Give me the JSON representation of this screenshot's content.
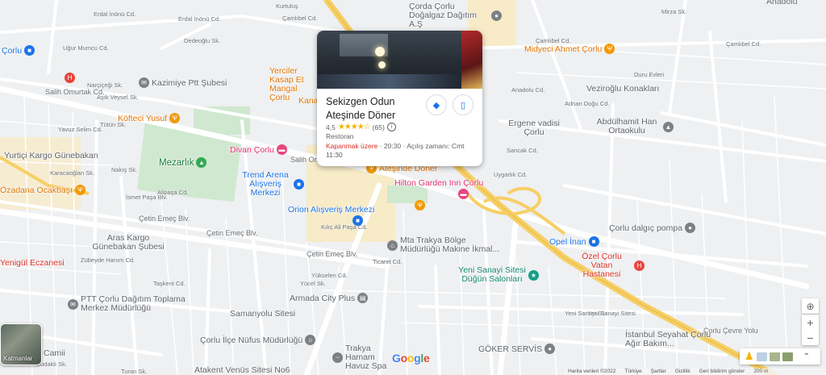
{
  "map": {
    "streets": [
      "Erdal İnönü Cd.",
      "Erdal İnönü Cd.",
      "Kurtuluş",
      "Çamlıbel Cd.",
      "Çamlıbel Cd.",
      "Çamlıbel Cd.",
      "Dedeoğlu Sk.",
      "Uğur Mumcu Cd.",
      "Narçiçeği Sk.",
      "Aşık Veysel Sk.",
      "Salih Omurtak Cd.",
      "Salih Omurtak Cd.",
      "Tütün Sk.",
      "Yavuz Selim Cd.",
      "Nakış Sk.",
      "Karacaoğlan Sk.",
      "İsmet Paşa Blv.",
      "Alipaşa Cd.",
      "Çetin Emeç Blv.",
      "Çetin Emeç Blv.",
      "Çetin Emeç Blv.",
      "Kılıç Ali Paşa Cd.",
      "Ticaret Cd.",
      "Yükselen Cd.",
      "Yücel Sk.",
      "Sancak Cd.",
      "Uygarlık Cd.",
      "Adnan Doğu Cd.",
      "Anadolu Cd.",
      "Duru Evleri",
      "Yeni Sanayi Sk.",
      "Yeni Sanayi Sitesi",
      "Çorlu Çevre Yolu",
      "Budaklı Sk.",
      "Turan Sk.",
      "Mirza Sk.",
      "Taşkent Cd.",
      "Zübeyde Hanım Cd."
    ],
    "pois": [
      {
        "label": "Çorlu",
        "color": "blue",
        "icon": "shop-icon"
      },
      {
        "label": "Kazimiye Ptt Şubesi",
        "color": "gray",
        "icon": "mail-icon"
      },
      {
        "label": "Köfteci Yusuf",
        "color": "orange",
        "icon": "restaurant-icon"
      },
      {
        "label": "Mezarlık",
        "color": "green",
        "icon": "cemetery-icon"
      },
      {
        "label": "Divan Çorlu",
        "color": "pink",
        "icon": "hotel-icon"
      },
      {
        "label": "Trend Arena Alışveriş Merkezi",
        "color": "blue",
        "icon": "shopping-icon"
      },
      {
        "label": "Yurtiçi Kargo Günebakan",
        "color": "gray",
        "icon": "office-icon"
      },
      {
        "label": "Özadana Ocakbaşı",
        "color": "orange",
        "icon": "restaurant-icon"
      },
      {
        "label": "Orion Alışveriş Merkezi",
        "color": "blue",
        "icon": "shopping-icon"
      },
      {
        "label": "Aras Kargo Günebakan Şubesi",
        "color": "gray",
        "icon": "office-icon"
      },
      {
        "label": "Yenigül Eczanesi",
        "color": "red",
        "icon": "pharmacy-icon"
      },
      {
        "label": "PTT Çorlu Dağıtım Toplama Merkez Müdürlüğü",
        "color": "gray",
        "icon": "mail-icon"
      },
      {
        "label": "Samanyolu Sitesi",
        "color": "gray",
        "icon": "building-icon"
      },
      {
        "label": "Armada City Plus",
        "color": "gray",
        "icon": "building-icon"
      },
      {
        "label": "Çorlu İlçe Nüfus Müdürlüğü",
        "color": "gray",
        "icon": "government-icon"
      },
      {
        "label": "Atakent Venüs Sitesi No6",
        "color": "gray",
        "icon": "building-icon"
      },
      {
        "label": "Camii",
        "color": "gray",
        "icon": "mosque-icon"
      },
      {
        "label": "Trakya Hamam Havuz Spa",
        "color": "gray",
        "icon": "spa-icon"
      },
      {
        "label": "Mta Trakya Bölge Müdürlüğü Makine İkmal...",
        "color": "gray",
        "icon": "government-icon"
      },
      {
        "label": "Yeni Sanayi Sitesi Düğün Salonları",
        "color": "teal",
        "icon": "event-icon"
      },
      {
        "label": "Hilton Garden Inn Çorlu",
        "color": "pink",
        "icon": "hotel-icon"
      },
      {
        "label": "Ateşinde Döner",
        "color": "orange",
        "icon": "restaurant-icon"
      },
      {
        "label": "Yerciler Kasap Et Mangal Çorlu",
        "color": "orange",
        "icon": "restaurant-icon"
      },
      {
        "label": "Kana",
        "color": "orange",
        "icon": "restaurant-icon"
      },
      {
        "label": "Çorda Çorlu Doğalgaz Dağıtım A.Ş",
        "color": "gray",
        "icon": "office-icon"
      },
      {
        "label": "Midyeci Ahmet Çorlu",
        "color": "orange",
        "icon": "restaurant-icon"
      },
      {
        "label": "Veziroğlu Konakları",
        "color": "gray",
        "icon": "building-icon"
      },
      {
        "label": "Ergene vadisi Çorlu",
        "color": "gray",
        "icon": "building-icon"
      },
      {
        "label": "Abdülhamit Han Ortaokulu",
        "color": "gray",
        "icon": "school-icon"
      },
      {
        "label": "Çorlu dalgıç pompa",
        "color": "gray",
        "icon": "office-icon"
      },
      {
        "label": "Opel İnan",
        "color": "blue",
        "icon": "shopping-icon"
      },
      {
        "label": "Özel Çorlu Vatan Hastanesi",
        "color": "red",
        "icon": "hospital-icon"
      },
      {
        "label": "İstanbul Seyahat Çorlu Ağır Bakım...",
        "color": "gray",
        "icon": "office-icon"
      },
      {
        "label": "GÖKER SERVİS",
        "color": "gray",
        "icon": "office-icon"
      },
      {
        "label": "Anadolu",
        "color": "gray",
        "icon": "building-icon"
      }
    ]
  },
  "place_card": {
    "name": "Sekizgen Odun Ateşinde Döner",
    "rating": "4,5",
    "stars": 4.5,
    "review_count": "(65)",
    "category": "Restoran",
    "status": "Kapanmak üzere",
    "hours": "· 20:30 · Açılış zamanı: Cmt 11:30"
  },
  "controls": {
    "layers_label": "Katmanlar",
    "zoom_in": "+",
    "zoom_out": "−"
  },
  "footer": {
    "brand": "Google",
    "items": [
      "Harita verileri ©2022",
      "Türkiye",
      "Şartlar",
      "Gizlilik",
      "Geri bildirim gönder",
      "200 m"
    ]
  }
}
